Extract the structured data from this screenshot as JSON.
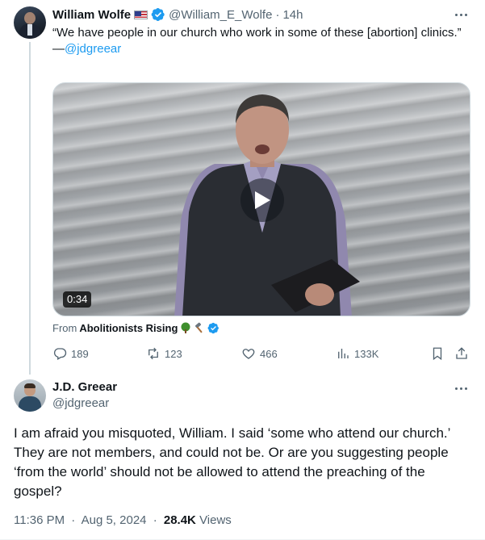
{
  "tweet1": {
    "author_name": "William Wolfe",
    "handle": "@William_E_Wolfe",
    "separator": "·",
    "time": "14h",
    "text": "“We have people in our church who work in some of these [abortion] clinics.”",
    "attribution_prefix": "—",
    "attribution_mention": "@jdgreear",
    "video": {
      "duration": "0:34"
    },
    "from_label": "From",
    "from_source": "Abolitionists Rising",
    "actions": {
      "replies": "189",
      "reposts": "123",
      "likes": "466",
      "views": "133K"
    }
  },
  "tweet2": {
    "author_name": "J.D. Greear",
    "handle": "@jdgreear",
    "text": "I am afraid you misquoted, William. I said ‘some who attend our church.’ They are not members, and could not be. Or are you suggesting people ‘from the world’ should not be allowed to attend the preaching of the gospel?",
    "time": "11:36 PM",
    "separator": "·",
    "date": "Aug 5, 2024",
    "views_count": "28.4K",
    "views_label": "Views"
  },
  "colors": {
    "accent": "#1d9bf0",
    "muted_text": "#536471",
    "primary_text": "#0f1419",
    "thread_line": "#cfd9de"
  },
  "icons": [
    "verified-badge-icon",
    "us-flag-icon",
    "more-icon",
    "play-icon",
    "tree-emoji-icon",
    "hammer-emoji-icon",
    "reply-icon",
    "repost-icon",
    "like-icon",
    "views-icon",
    "bookmark-icon",
    "share-icon"
  ]
}
